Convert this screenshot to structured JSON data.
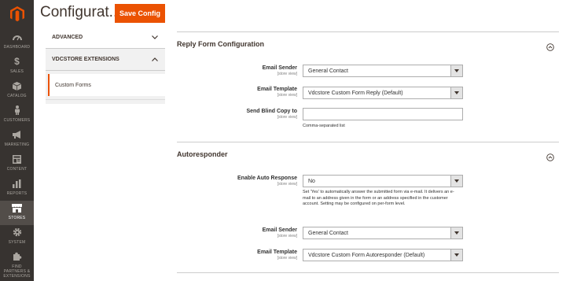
{
  "menu": {
    "items": [
      {
        "label": "DASHBOARD",
        "icon": "dashboard-icon"
      },
      {
        "label": "SALES",
        "icon": "dollar-icon"
      },
      {
        "label": "CATALOG",
        "icon": "box-icon"
      },
      {
        "label": "CUSTOMERS",
        "icon": "person-icon"
      },
      {
        "label": "MARKETING",
        "icon": "megaphone-icon"
      },
      {
        "label": "CONTENT",
        "icon": "content-icon"
      },
      {
        "label": "REPORTS",
        "icon": "bar-chart-icon"
      },
      {
        "label": "STORES",
        "icon": "store-icon"
      },
      {
        "label": "SYSTEM",
        "icon": "gear-icon"
      },
      {
        "label": "FIND PARTNERS & EXTENSIONS",
        "icon": "puzzle-icon"
      }
    ],
    "active": "STORES"
  },
  "header": {
    "title": "Configurat...",
    "save_label": "Save Config"
  },
  "config_nav": {
    "advanced": "ADVANCED",
    "vdcstore": "VDCSTORE EXTENSIONS",
    "custom_forms": "Custom Forms"
  },
  "reply": {
    "title": "Reply Form Configuration",
    "sender_label": "Email Sender",
    "sender_scope": "[store view]",
    "sender_value": "General Contact",
    "template_label": "Email Template",
    "template_scope": "[store view]",
    "template_value": "Vdcstore Custom Form Reply (Default)",
    "bcc_label": "Send Blind Copy to",
    "bcc_scope": "[store view]",
    "bcc_value": "",
    "bcc_note": "Comma-separated list"
  },
  "autoresponder": {
    "title": "Autoresponder",
    "enable_label": "Enable Auto Response",
    "enable_scope": "[store view]",
    "enable_value": "No",
    "enable_note": "Set 'Yes' to automatically answer the submitted form via e-mail. It delivers an e-mail to an address given in the form or an address specified in the customer account. Setting may be configured on per-form level.",
    "sender_label": "Email Sender",
    "sender_scope": "[store view]",
    "sender_value": "General Contact",
    "template_label": "Email Template",
    "template_scope": "[store view]",
    "template_value": "Vdcstore Custom Form Autoresponder (Default)"
  },
  "colors": {
    "accent": "#eb5202",
    "menu_bg": "#373330",
    "menu_active": "#524d49"
  }
}
